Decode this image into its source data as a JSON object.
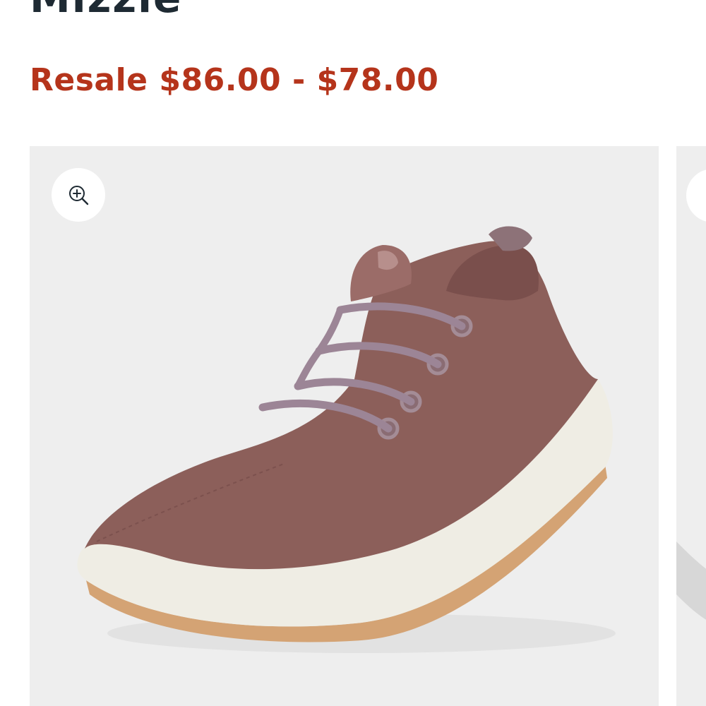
{
  "product": {
    "title": "Mizzle",
    "price_text": "Resale $86.00 - $78.00"
  },
  "gallery": {
    "zoom_icon": "zoom-in-icon",
    "background_color": "#eeeeee",
    "shoe_color": "#8c5f5a",
    "lace_color": "#9c8596",
    "sole_color": "#efede4",
    "outsole_color": "#d4a374"
  },
  "colors": {
    "title": "#1e2a33",
    "price": "#b5341b"
  }
}
